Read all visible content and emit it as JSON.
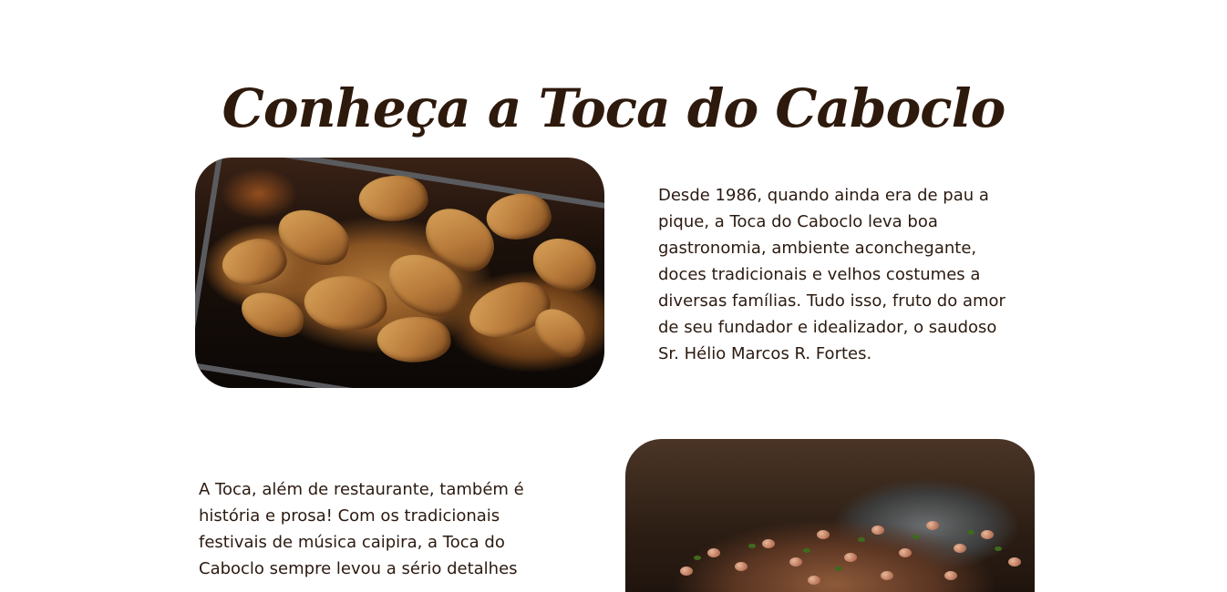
{
  "section": {
    "title": "Conheça a Toca do Caboclo"
  },
  "blocks": [
    {
      "image_alt": "torresmo",
      "text": "Desde 1986, quando ainda era de pau a pique, a Toca do Caboclo leva boa gastronomia, ambiente aconchegante, doces tradicionais e velhos costumes a diversas famílias. Tudo isso, fruto do amor de seu fundador e idealizador, o saudoso Sr. Hélio Marcos R. Fortes."
    },
    {
      "image_alt": "feijão tropeiro",
      "text": "A Toca, além de restaurante, também é história e prosa! Com os tradicionais festivais de música caipira, a Toca do Caboclo sempre levou a sério detalhes"
    }
  ],
  "colors": {
    "title": "#2e1a0c",
    "body_text": "#2b1a10",
    "background": "#ffffff"
  }
}
